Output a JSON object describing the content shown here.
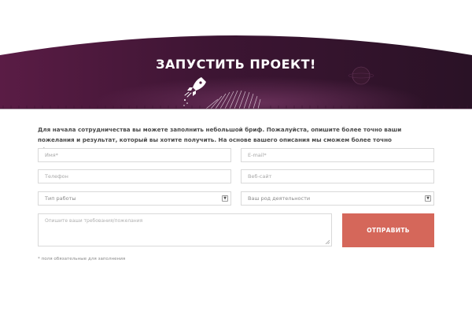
{
  "hero": {
    "title": "ЗАПУСТИТЬ ПРОЕКТ!",
    "background_color": "#4a1838",
    "icon": "rocket-icon"
  },
  "intro": {
    "text": "Для начала сотрудничества вы можете заполнить небольшой бриф. Пожалуйста, опишите более точно ваши пожелания и результат, который вы хотите получить. На основе вашего описания мы сможем более точно сформировать коммерческое предложение."
  },
  "form": {
    "name": {
      "placeholder": "Имя*",
      "value": ""
    },
    "email": {
      "placeholder": "E-mail*",
      "value": ""
    },
    "phone": {
      "placeholder": "Телефон",
      "value": ""
    },
    "website": {
      "placeholder": "Веб-сайт",
      "value": ""
    },
    "work_type": {
      "selected": "Тип работы"
    },
    "activity": {
      "selected": "Ваш род деятельности"
    },
    "message": {
      "placeholder": "Опишите ваши требования/пожелания",
      "value": ""
    },
    "submit_label": "ОТПРАВИТЬ",
    "submit_color": "#d5675a",
    "required_note": "* поля обязательные для заполнения"
  }
}
